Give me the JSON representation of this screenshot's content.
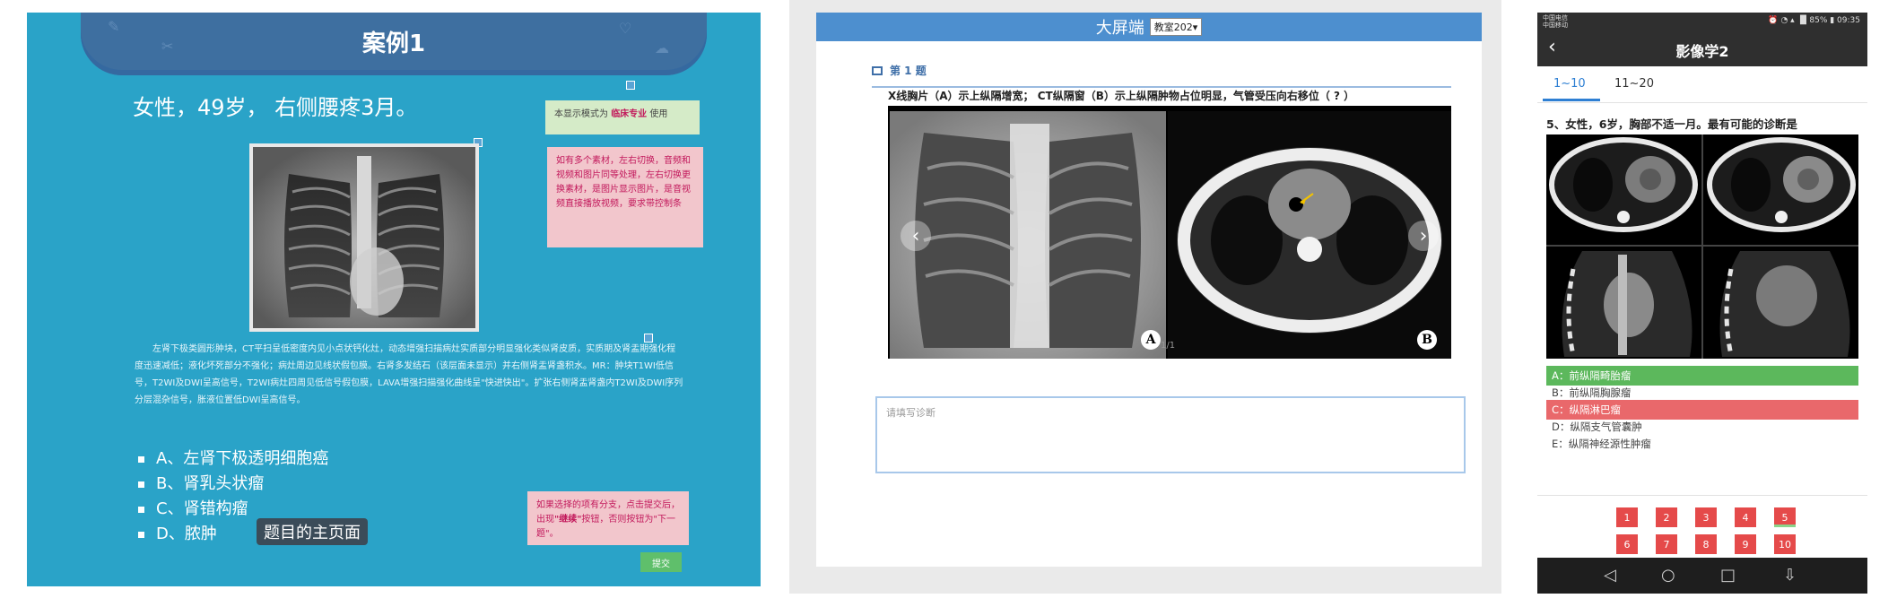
{
  "panel1": {
    "case_title": "案例1",
    "stem": "女性，49岁，  右侧腰疼3月。",
    "note_green_prefix": "本显示模式为",
    "note_green_bold": "临床专业",
    "note_green_suffix": "使用",
    "note_pink": "如有多个素材，左右切换，音频和视频和图片同等处理，左右切换更换素材，是图片显示图片，是音视频直接播放视频，要求带控制条",
    "description": "左肾下极类圆形肿块，CT平扫呈低密度内见小点状钙化灶，动态增强扫描病灶实质部分明显强化类似肾皮质，实质期及肾盂期强化程度迅速减低；液化坏死部分不强化；病灶周边见线状假包膜。右肾多发结石（该层面未显示）并右侧肾盂肾盏积水。MR：肿块T1WI低信号，T2WI及DWI呈高信号，T2WI病灶四周见低信号假包膜，LAVA增强扫描强化曲线呈\"快进快出\"。扩张右侧肾盂肾盏内T2WI及DWI序列分层混杂信号，胀液位置低DWI呈高信号。",
    "options": [
      "A、左肾下极透明细胞癌",
      "B、肾乳头状瘤",
      "C、肾错构瘤",
      "D、脓肿"
    ],
    "main_page_label": "题目的主页面",
    "note_pink2_pre": "如果选择的项有分支，点击提交后，出现",
    "note_pink2_bold": "\"继续\"",
    "note_pink2_post": "按钮，否则按钮为\"下一题\"。",
    "submit_label": "提交"
  },
  "panel2": {
    "title": "大屏端",
    "select_value": "教室202",
    "question_heading": "第 1 题",
    "question_text": "X线胸片（A）示上纵隔增宽；  CT纵隔窗（B）示上纵隔肿物占位明显，气管受压向右移位（  ?  ）",
    "label_a": "A",
    "label_b": "B",
    "pager": "1/1",
    "diagnosis_placeholder": "请填写诊断"
  },
  "panel3": {
    "status_left_1": "中国电信",
    "status_left_2": "中国移动",
    "status_right": "⏰ ◔ ▴ ▐▌85% ▮ 09:35",
    "title": "影像学2",
    "tabs": [
      "1~10",
      "11~20"
    ],
    "question": "5、女性，6岁，胸部不适一月。最有可能的诊断是",
    "answers": [
      {
        "text": "A：前纵隔畸胎瘤",
        "state": "correct"
      },
      {
        "text": "B：前纵隔胸腺瘤",
        "state": "normal"
      },
      {
        "text": "C：纵隔淋巴瘤",
        "state": "wrong"
      },
      {
        "text": "D：纵隔支气管囊肿",
        "state": "normal"
      },
      {
        "text": "E：纵隔神经源性肿瘤",
        "state": "normal"
      }
    ],
    "numbers": [
      "1",
      "2",
      "3",
      "4",
      "5",
      "6",
      "7",
      "8",
      "9",
      "10"
    ],
    "nav_icons": [
      "back-triangle",
      "home-circle",
      "recent-square",
      "menu-down"
    ]
  }
}
